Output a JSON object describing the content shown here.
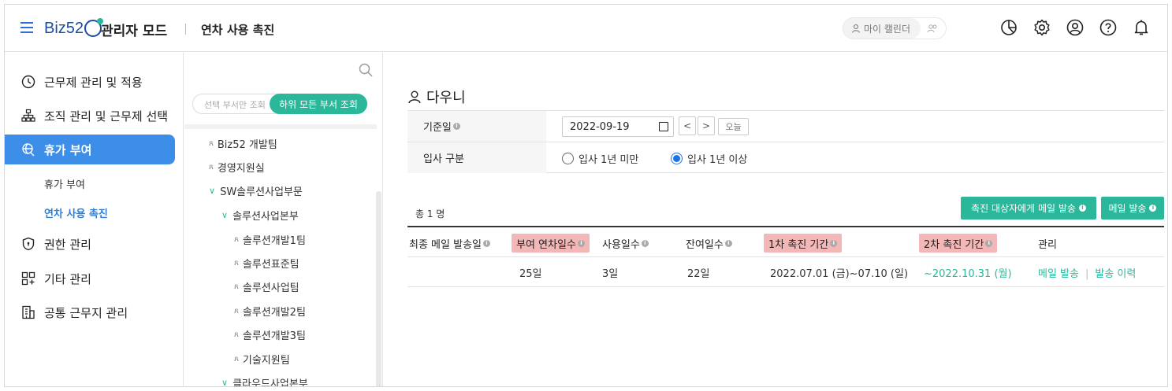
{
  "header": {
    "logo_text": "Biz52",
    "mode_title": "관리자 모드",
    "page_title": "연차 사용 촉진",
    "my_calendar_label": "마이 캘린더",
    "icons": [
      "menu-icon",
      "pie-chart-icon",
      "gear-icon",
      "user-circle-icon",
      "help-icon",
      "bell-icon"
    ]
  },
  "nav": {
    "items": [
      {
        "label": "근무제 관리 및 적용",
        "icon": "clock-icon"
      },
      {
        "label": "조직 관리 및 근무제 선택",
        "icon": "org-chart-icon"
      },
      {
        "label": "휴가 부여",
        "icon": "vacation-icon",
        "active": true
      },
      {
        "label": "권한 관리",
        "icon": "shield-icon"
      },
      {
        "label": "기타 관리",
        "icon": "grid-icon"
      },
      {
        "label": "공통 근무지 관리",
        "icon": "building-icon"
      }
    ],
    "sub_items": [
      {
        "label": "휴가 부여"
      },
      {
        "label": "연차 사용 촉진",
        "active": true
      }
    ]
  },
  "tree": {
    "toggle_off_label": "선택 부서만 조회",
    "toggle_on_label": "하위 모든 부서 조회",
    "items": [
      {
        "label": "Biz52 개발팀"
      },
      {
        "label": "경영지원실"
      },
      {
        "label": "SW솔루션사업부문"
      },
      {
        "label": "솔루션사업본부"
      },
      {
        "label": "솔루션개발1팀"
      },
      {
        "label": "솔루션표준팀"
      },
      {
        "label": "솔루션사업팀"
      },
      {
        "label": "솔루션개발2팀"
      },
      {
        "label": "솔루션개발3팀"
      },
      {
        "label": "기술지원팀"
      },
      {
        "label": "클라우드사업본부"
      }
    ]
  },
  "main": {
    "employee_name": "다우니",
    "form": {
      "base_date_label": "기준일",
      "base_date_value": "2022-09-19",
      "today_label": "오늘",
      "join_type_label": "입사 구분",
      "radio_under": "입사 1년 미만",
      "radio_over": "입사 1년 이상",
      "radio_selected": "over"
    },
    "total_label": "총 1 명",
    "btn_send_to_targets": "촉진 대상자에게 메일 발송",
    "btn_send_mail": "메일 발송",
    "table": {
      "headers": [
        "최종 메일 발송일",
        "부여 연차일수",
        "사용일수",
        "잔여일수",
        "1차 촉진 기간",
        "2차 촉진 기간",
        "관리"
      ],
      "rows": [
        {
          "last_mail": "",
          "granted": "25일",
          "used": "3일",
          "remaining": "22일",
          "period1": "2022.07.01 (금)~07.10 (일)",
          "period2": "~2022.10.31 (월)",
          "action_send": "메일 발송",
          "action_history": "발송 이력"
        }
      ]
    }
  },
  "colors": {
    "accent_blue": "#3d8ee8",
    "teal": "#2bb89a",
    "highlight_pink": "#f4b7b7"
  }
}
